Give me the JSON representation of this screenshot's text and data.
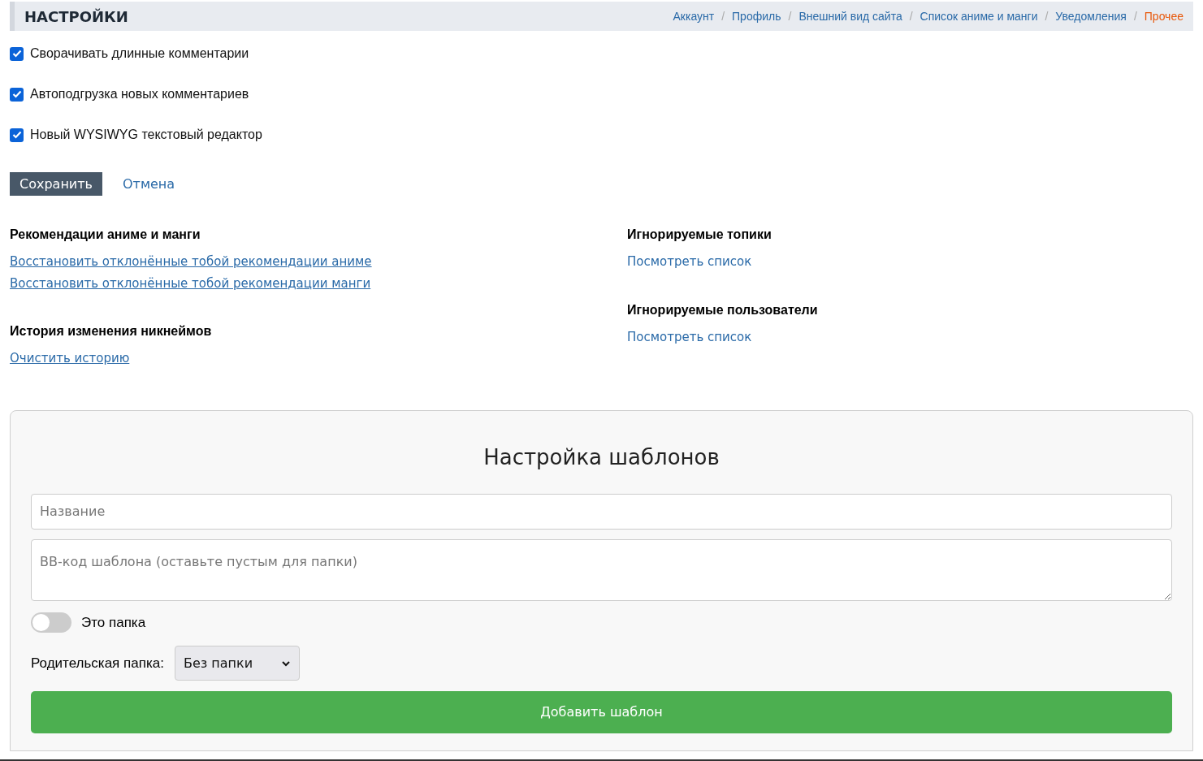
{
  "header": {
    "title": "НАСТРОЙКИ",
    "nav": [
      {
        "label": "Аккаунт",
        "selected": false
      },
      {
        "label": "Профиль",
        "selected": false
      },
      {
        "label": "Внешний вид сайта",
        "selected": false
      },
      {
        "label": "Список аниме и манги",
        "selected": false
      },
      {
        "label": "Уведомления",
        "selected": false
      },
      {
        "label": "Прочее",
        "selected": true
      }
    ],
    "separator": "/"
  },
  "options": [
    {
      "label": "Сворачивать длинные комментарии",
      "checked": true
    },
    {
      "label": "Автоподгрузка новых комментариев",
      "checked": true
    },
    {
      "label": "Новый WYSIWYG текстовый редактор",
      "checked": true
    }
  ],
  "actions": {
    "save": "Сохранить",
    "cancel": "Отмена"
  },
  "sections": {
    "left": [
      {
        "heading": "Рекомендации аниме и манги",
        "links": [
          "Восстановить отклонённые тобой рекомендации аниме",
          "Восстановить отклонённые тобой рекомендации манги"
        ]
      },
      {
        "heading": "История изменения никнеймов",
        "links": [
          "Очистить историю"
        ]
      }
    ],
    "right": [
      {
        "heading": "Игнорируемые топики",
        "links": [
          "Посмотреть список"
        ]
      },
      {
        "heading": "Игнорируемые пользователи",
        "links": [
          "Посмотреть список"
        ]
      }
    ]
  },
  "templates": {
    "title": "Настройка шаблонов",
    "name_field": {
      "placeholder": "Название"
    },
    "code_field": {
      "placeholder": "BB-код шаблона (оставьте пустым для папки)"
    },
    "folder_toggle": {
      "label": "Это папка",
      "on": false
    },
    "parent_folder": {
      "label": "Родительская папка:",
      "value": "Без папки"
    },
    "submit": "Добавить шаблон"
  }
}
